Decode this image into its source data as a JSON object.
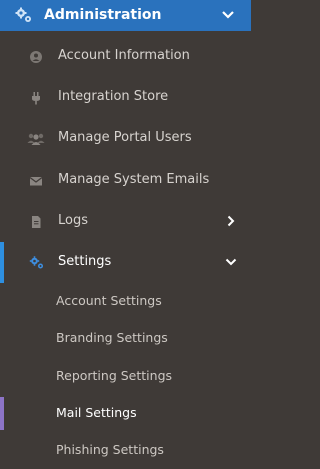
{
  "header": {
    "title": "Administration",
    "icon": "gears-icon",
    "chevron": "chevron-down-icon",
    "bg": "#2a72bd"
  },
  "items": [
    {
      "label": "Account Information",
      "icon": "user-circle-icon"
    },
    {
      "label": "Integration Store",
      "icon": "plug-icon"
    },
    {
      "label": "Manage Portal Users",
      "icon": "users-icon"
    },
    {
      "label": "Manage System Emails",
      "icon": "envelope-icon"
    },
    {
      "label": "Logs",
      "icon": "document-icon",
      "arrow": "chevron-right-icon"
    },
    {
      "label": "Settings",
      "icon": "gears-icon",
      "arrow": "chevron-down-icon",
      "active": true
    }
  ],
  "subitems": [
    {
      "label": "Account Settings"
    },
    {
      "label": "Branding Settings"
    },
    {
      "label": "Reporting Settings"
    },
    {
      "label": "Mail Settings",
      "current": true
    },
    {
      "label": "Phishing Settings"
    }
  ],
  "colors": {
    "sidebar_bg": "#3f3a37",
    "active_indicator": "#2e8fe0",
    "subitem_indicator": "#8d74c7"
  }
}
